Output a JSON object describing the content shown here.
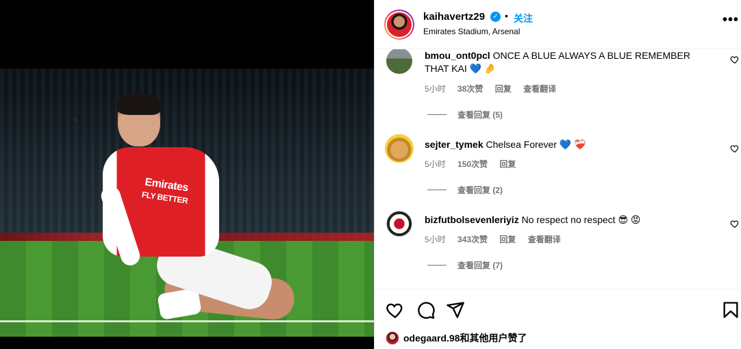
{
  "post": {
    "username": "kaihavertz29",
    "verified_mark": "✓",
    "separator": "•",
    "follow_label": "关注",
    "location": "Emirates Stadium, Arsenal",
    "more_label": "•••",
    "jersey_text_line1": "Emirates",
    "jersey_text_line2": "FLY BETTER"
  },
  "comments": [
    {
      "username": "bmou_ont0pcl",
      "text": "ONCE A BLUE ALWAYS A BLUE REMEMBER THAT KAI 💙 🤌",
      "time": "5小时",
      "likes": "38次赞",
      "reply_label": "回复",
      "translate_label": "查看翻译",
      "view_replies": "查看回复 (5)"
    },
    {
      "username": "sejter_tymek",
      "text": "Chelsea Forever 💙 ❤️‍🩹",
      "time": "5小时",
      "likes": "150次赞",
      "reply_label": "回复",
      "translate_label": "",
      "view_replies": "查看回复 (2)"
    },
    {
      "username": "bizfutbolsevenleriyiz",
      "text": "No respect no respect 😎 😡",
      "time": "5小时",
      "likes": "343次赞",
      "reply_label": "回复",
      "translate_label": "查看翻译",
      "view_replies": "查看回复 (7)"
    }
  ],
  "actions": {
    "icons": [
      "heart-icon",
      "comment-icon",
      "share-icon",
      "bookmark-icon"
    ]
  },
  "likes_line": {
    "user": "odegaard.98",
    "suffix": "和",
    "others": "其他用户",
    "tail": "赞了"
  }
}
